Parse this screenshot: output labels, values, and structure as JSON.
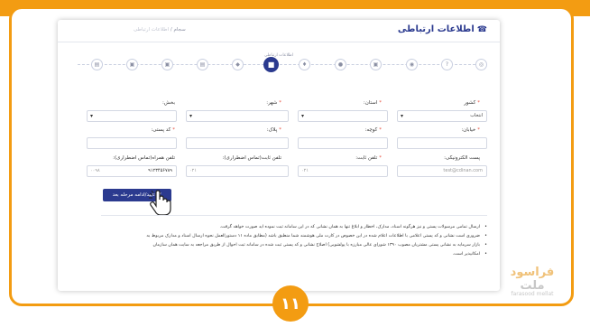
{
  "colors": {
    "accent": "#f39c12",
    "primary": "#2b3a8f"
  },
  "header": {
    "title": "اطلاعات ارتباطی",
    "title_icon": "phone-icon",
    "breadcrumb_home": "سجام",
    "breadcrumb_sep": "/",
    "breadcrumb_current": "اطلاعات ارتباطی"
  },
  "steps": {
    "active_label": "اطلاعات ارتباطی",
    "icons": [
      "step1-icon",
      "step2-icon",
      "step3-icon",
      "step4-icon",
      "step5-icon",
      "step6-icon",
      "step7-icon",
      "step8-icon",
      "step9-icon",
      "step10-icon",
      "step11-icon",
      "step12-icon"
    ],
    "glyphs": [
      "◎",
      "?",
      "◉",
      "▣",
      "●",
      "♦",
      "■",
      "◆",
      "▤",
      "▣",
      "▣",
      "▤"
    ]
  },
  "form": {
    "country_label": "کشور",
    "country_value": "انتخاب",
    "province_label": "استان:",
    "city_label": "شهر:",
    "district_label": "بخش:",
    "street_label": "خیابان:",
    "alley_label": "کوچه:",
    "plaque_label": "پلاک:",
    "postal_label": "کد پستی:",
    "email_label": "پست الکترونیکی:",
    "email_placeholder": "test@cdinan.com",
    "fixed_phone_label": "تلفن ثابت:",
    "fixed_phone_prefix": "۰۲۱",
    "emergency_fixed_label": "تلفن ثابت(تماس اضطراری):",
    "emergency_fixed_prefix": "۰۲۱",
    "emergency_mobile_label": "تلفن همراه(تماس اضطراری):",
    "emergency_mobile_prefix": "۰۰۹۸",
    "emergency_mobile_value": "۹۱۲۳۴۵۶۷۸۹"
  },
  "submit_label": "تایید/ادامه مرحله بعد",
  "notes": [
    "ارسال تمامی مرسولات پستی و نیز هرگونه اسناد، مدارک، اخطار و ابلاغ تنها به همان نشانی که در این سامانه ثبت نموده اید صورت خواهد گرفت.",
    "ضروری است نشانی و کد پستی اعلامی با اطلاعات اعلام شده در این خصوص در کارت ملی هوشمند شما منطبق باشد (مطابق ماده ۱۱ دستورالعمل نحوه ارسال اسناد و مدارک مربوط به",
    "بازار سرمایه به نشانی پستی مشتریان مصوب ۱۳۹۰ شورای عالی مبارزه با پولشویی) اصلاح نشانی و کد پستی ثبت شده در سامانه ثبت احوال از طریق مراجعه به سایت همان سازمان",
    "امکانپذیر است."
  ],
  "brand": {
    "fa_main": "فراسود",
    "fa_tail": "ملت",
    "en": "farasood mellat"
  },
  "step_number": "۱۱"
}
